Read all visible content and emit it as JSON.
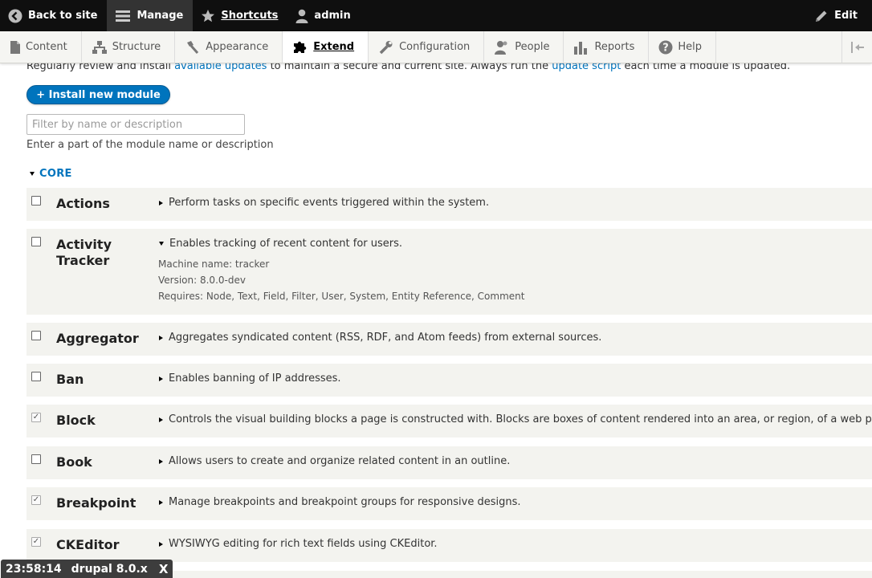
{
  "toolbar": {
    "back": {
      "label": "Back to site",
      "icon": "back-arrow-icon"
    },
    "manage": {
      "label": "Manage",
      "icon": "menu-icon"
    },
    "shortcuts": {
      "label": "Shortcuts",
      "icon": "star-icon"
    },
    "user": {
      "label": "admin",
      "icon": "user-icon"
    },
    "edit": {
      "label": "Edit",
      "icon": "pencil-icon"
    }
  },
  "tray": {
    "items": [
      {
        "label": "Content",
        "icon": "file-icon"
      },
      {
        "label": "Structure",
        "icon": "structure-icon"
      },
      {
        "label": "Appearance",
        "icon": "paintbrush-icon"
      },
      {
        "label": "Extend",
        "icon": "puzzle-icon",
        "active": true
      },
      {
        "label": "Configuration",
        "icon": "wrench-icon"
      },
      {
        "label": "People",
        "icon": "people-icon"
      },
      {
        "label": "Reports",
        "icon": "bar-chart-icon"
      },
      {
        "label": "Help",
        "icon": "help-icon"
      }
    ],
    "collapse_icon": "collapse-left-icon"
  },
  "intro": {
    "text1": "Regularly review and install ",
    "link1": "available updates",
    "text2": " to maintain a secure and current site. Always run the ",
    "link2": "update script",
    "text3": " each time a module is updated."
  },
  "install_button": "+ Install new module",
  "filter": {
    "placeholder": "Filter by name or description",
    "value": "",
    "description": "Enter a part of the module name or description"
  },
  "section": {
    "title": "CORE"
  },
  "modules": [
    {
      "name": "Actions",
      "checked": false,
      "description": "Perform tasks on specific events triggered within the system."
    },
    {
      "name": "Activity Tracker",
      "checked": false,
      "description": "Enables tracking of recent content for users.",
      "expanded": true,
      "machine_name": "Machine name: tracker",
      "version": "Version: 8.0.0-dev",
      "requires": "Requires: Node, Text, Field, Filter, User, System, Entity Reference, Comment"
    },
    {
      "name": "Aggregator",
      "checked": false,
      "description": "Aggregates syndicated content (RSS, RDF, and Atom feeds) from external sources."
    },
    {
      "name": "Ban",
      "checked": false,
      "description": "Enables banning of IP addresses."
    },
    {
      "name": "Block",
      "checked": true,
      "description": "Controls the visual building blocks a page is constructed with. Blocks are boxes of content rendered into an area, or region, of a web pa"
    },
    {
      "name": "Book",
      "checked": false,
      "description": "Allows users to create and organize related content in an outline."
    },
    {
      "name": "Breakpoint",
      "checked": true,
      "description": "Manage breakpoints and breakpoint groups for responsive designs."
    },
    {
      "name": "CKEditor",
      "checked": true,
      "description": "WYSIWYG editing for rich text fields using CKEditor."
    }
  ],
  "badge": {
    "time": "23:58:14",
    "label": "drupal 8.0.x",
    "close": "X"
  }
}
